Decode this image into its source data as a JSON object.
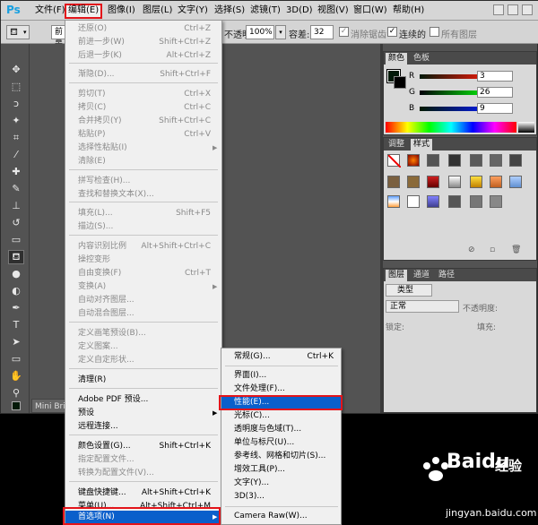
{
  "app": {
    "logo": "Ps",
    "menus": [
      "文件(F)",
      "编辑(E)",
      "图像(I)",
      "图层(L)",
      "文字(Y)",
      "选择(S)",
      "滤镜(T)",
      "3D(D)",
      "视图(V)",
      "窗口(W)",
      "帮助(H)"
    ],
    "active_menu": "编辑(E)"
  },
  "options_bar": {
    "preset_label": "前景",
    "opacity_label": "不透明度:",
    "opacity_value": "100%",
    "tolerance_label": "容差:",
    "tolerance_value": "32",
    "antialias_label": "消除锯齿",
    "contiguous_label": "连续的",
    "all_layers_label": "所有图层"
  },
  "minibridge_tab": "Mini Brid",
  "color_panel": {
    "tabs": [
      "颜色",
      "色板"
    ],
    "r_label": "R",
    "g_label": "G",
    "b_label": "B",
    "r_value": "3",
    "g_value": "26",
    "b_value": "9"
  },
  "styles_panel": {
    "tabs": [
      "调整",
      "样式"
    ]
  },
  "layers_panel": {
    "tabs": [
      "图层",
      "通道",
      "路径"
    ],
    "filter_label": "类型",
    "blend_mode": "正常",
    "opacity_label": "不透明度:",
    "lock_label": "锁定:",
    "fill_label": "填充:"
  },
  "edit_menu": {
    "items": [
      {
        "label": "还原(O)",
        "shortcut": "Ctrl+Z",
        "enabled": false
      },
      {
        "label": "前进一步(W)",
        "shortcut": "Shift+Ctrl+Z",
        "enabled": false
      },
      {
        "label": "后退一步(K)",
        "shortcut": "Alt+Ctrl+Z",
        "enabled": false
      },
      {
        "label": "渐隐(D)...",
        "shortcut": "Shift+Ctrl+F",
        "enabled": false
      },
      {
        "label": "剪切(T)",
        "shortcut": "Ctrl+X",
        "enabled": false
      },
      {
        "label": "拷贝(C)",
        "shortcut": "Ctrl+C",
        "enabled": false
      },
      {
        "label": "合并拷贝(Y)",
        "shortcut": "Shift+Ctrl+C",
        "enabled": false
      },
      {
        "label": "粘贴(P)",
        "shortcut": "Ctrl+V",
        "enabled": false
      },
      {
        "label": "选择性粘贴(I)",
        "shortcut": "",
        "enabled": false
      },
      {
        "label": "清除(E)",
        "shortcut": "",
        "enabled": false
      },
      {
        "label": "拼写检查(H)...",
        "shortcut": "",
        "enabled": false
      },
      {
        "label": "查找和替换文本(X)...",
        "shortcut": "",
        "enabled": false
      },
      {
        "label": "填充(L)...",
        "shortcut": "Shift+F5",
        "enabled": false
      },
      {
        "label": "描边(S)...",
        "shortcut": "",
        "enabled": false
      },
      {
        "label": "内容识别比例",
        "shortcut": "Alt+Shift+Ctrl+C",
        "enabled": false
      },
      {
        "label": "操控变形",
        "shortcut": "",
        "enabled": false
      },
      {
        "label": "自由变换(F)",
        "shortcut": "Ctrl+T",
        "enabled": false
      },
      {
        "label": "变换(A)",
        "shortcut": "",
        "enabled": false
      },
      {
        "label": "自动对齐图层...",
        "shortcut": "",
        "enabled": false
      },
      {
        "label": "自动混合图层...",
        "shortcut": "",
        "enabled": false
      },
      {
        "label": "定义画笔预设(B)...",
        "shortcut": "",
        "enabled": false
      },
      {
        "label": "定义图案...",
        "shortcut": "",
        "enabled": false
      },
      {
        "label": "定义自定形状...",
        "shortcut": "",
        "enabled": false
      },
      {
        "label": "清理(R)",
        "shortcut": "",
        "enabled": true
      },
      {
        "label": "Adobe PDF 预设...",
        "shortcut": "",
        "enabled": true
      },
      {
        "label": "预设",
        "shortcut": "",
        "enabled": true
      },
      {
        "label": "远程连接...",
        "shortcut": "",
        "enabled": true
      },
      {
        "label": "颜色设置(G)...",
        "shortcut": "Shift+Ctrl+K",
        "enabled": true
      },
      {
        "label": "指定配置文件...",
        "shortcut": "",
        "enabled": false
      },
      {
        "label": "转换为配置文件(V)...",
        "shortcut": "",
        "enabled": false
      },
      {
        "label": "键盘快捷键...",
        "shortcut": "Alt+Shift+Ctrl+K",
        "enabled": true
      },
      {
        "label": "菜单(U)...",
        "shortcut": "Alt+Shift+Ctrl+M",
        "enabled": true
      },
      {
        "label": "首选项(N)",
        "shortcut": "",
        "enabled": true
      }
    ]
  },
  "prefs_submenu": {
    "items": [
      {
        "label": "常规(G)...",
        "shortcut": "Ctrl+K"
      },
      {
        "label": "界面(I)...",
        "shortcut": ""
      },
      {
        "label": "文件处理(F)...",
        "shortcut": ""
      },
      {
        "label": "性能(E)...",
        "shortcut": ""
      },
      {
        "label": "光标(C)...",
        "shortcut": ""
      },
      {
        "label": "透明度与色域(T)...",
        "shortcut": ""
      },
      {
        "label": "单位与标尺(U)...",
        "shortcut": ""
      },
      {
        "label": "参考线、网格和切片(S)...",
        "shortcut": ""
      },
      {
        "label": "增效工具(P)...",
        "shortcut": ""
      },
      {
        "label": "文字(Y)...",
        "shortcut": ""
      },
      {
        "label": "3D(3)...",
        "shortcut": ""
      },
      {
        "label": "Camera Raw(W)...",
        "shortcut": ""
      }
    ]
  },
  "watermark": {
    "brand": "Baidu",
    "brand_cn": "经验",
    "url": "jingyan.baidu.com"
  },
  "colors": {
    "highlight": "#0a5fcb",
    "callout_red": "#e3141a",
    "app_bg": "#535353",
    "menu_bg": "#f0f0f0"
  }
}
